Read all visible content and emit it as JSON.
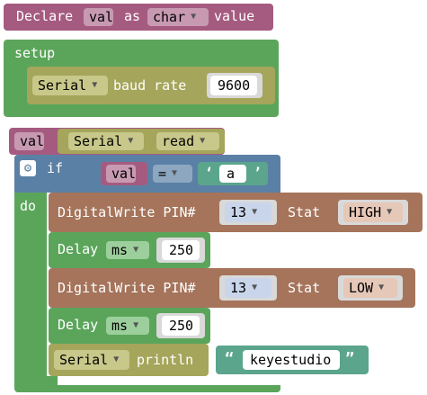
{
  "declare": {
    "keyword": "Declare",
    "var": "val",
    "as": "as",
    "type": "char",
    "value": "value"
  },
  "setup": {
    "label": "setup",
    "serial_begin": {
      "serial": "Serial",
      "label": "baud rate",
      "baud": "9600"
    }
  },
  "assign": {
    "var": "val",
    "serial": "Serial",
    "method": "read"
  },
  "if_block": {
    "if_label": "if",
    "do_label": "do",
    "condition": {
      "var": "val",
      "op": "=",
      "open_quote": "‘",
      "char": "a",
      "close_quote": "’"
    }
  },
  "body": [
    {
      "kind": "digitalwrite",
      "label": "DigitalWrite PIN#",
      "pin": "13",
      "stat_label": "Stat",
      "stat": "HIGH"
    },
    {
      "kind": "delay",
      "label": "Delay",
      "unit": "ms",
      "value": "250"
    },
    {
      "kind": "digitalwrite",
      "label": "DigitalWrite PIN#",
      "pin": "13",
      "stat_label": "Stat",
      "stat": "LOW"
    },
    {
      "kind": "delay",
      "label": "Delay",
      "unit": "ms",
      "value": "250"
    },
    {
      "kind": "println",
      "serial": "Serial",
      "label": "println",
      "open_quote": "“",
      "text": "keyestudio",
      "close_quote": "”"
    }
  ],
  "icons": {
    "dropdown": "dropdown-arrow-icon",
    "gear": "gear-icon"
  },
  "colors": {
    "variable": "#a55b80",
    "setup": "#5ba55b",
    "serial": "#a5a55b",
    "serial_field": "#c8c88a",
    "logic": "#5b80a5",
    "pin": "#a5745b",
    "text": "#5ba58c",
    "delay": "#5ba55b"
  }
}
